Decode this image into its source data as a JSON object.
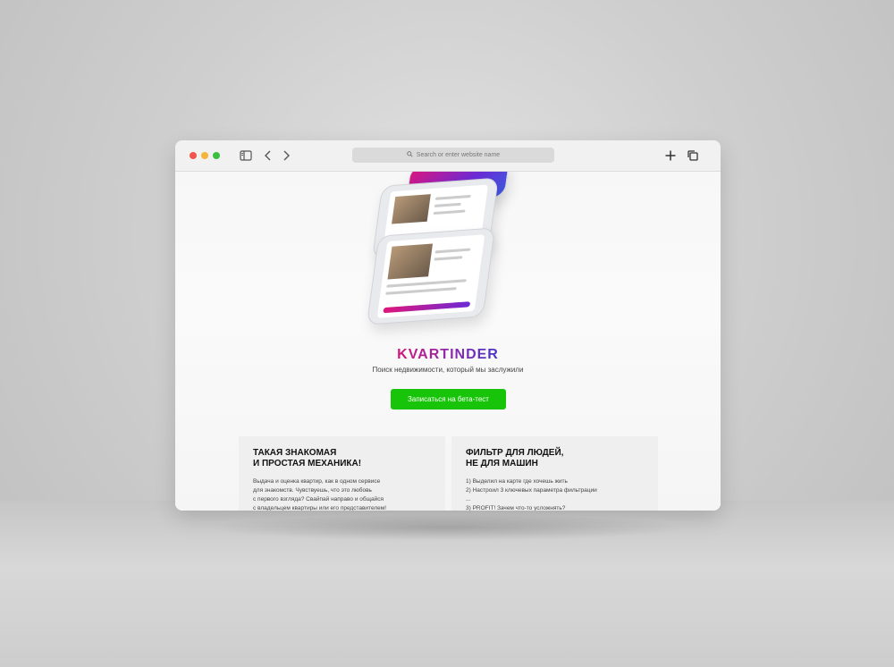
{
  "browser": {
    "url_placeholder": "Search or enter website name",
    "icons": [
      "sidebar-icon",
      "back-icon",
      "forward-icon",
      "search-icon",
      "new-tab-icon",
      "tabs-overview-icon"
    ]
  },
  "page": {
    "brand": "KVARTINDER",
    "tagline": "Поиск недвижимости, который мы заслужили",
    "cta_label": "Записаться на бета-тест",
    "cta_color": "#18c40a",
    "brand_gradient": [
      "#d4147a",
      "#4a34c8"
    ]
  },
  "features": [
    {
      "title": "ТАКАЯ ЗНАКОМАЯ\nИ ПРОСТАЯ МЕХАНИКА!",
      "text": "Выдача и оценка квартир, как в одном сервисе\nдля знакомств. Чувствуешь, что это любовь\nс первого взгляда? Свайпай направо и общайся\nс владельцем квартиры или его представителем!"
    },
    {
      "title": "ФИЛЬТР ДЛЯ ЛЮДЕЙ,\nНЕ ДЛЯ МАШИН",
      "text": "1) Выделил на карте где хочешь жить\n2) Настроил 3 ключевых параметра фильтрации\n...\n3) PROFIT! Зачем что-то усложнять?"
    }
  ]
}
